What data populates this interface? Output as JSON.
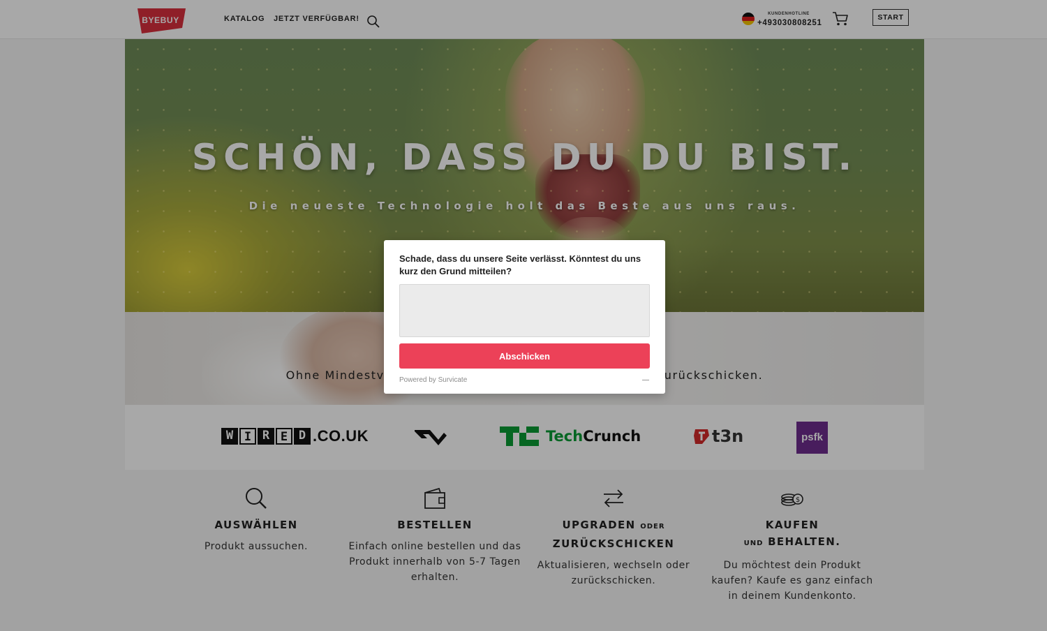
{
  "header": {
    "logo_text": "BYEBUY",
    "nav": [
      {
        "label": "KATALOG"
      },
      {
        "label": "JETZT VERFÜGBAR!"
      }
    ],
    "search_icon": "search-icon",
    "hotline_label": "KUNDENHOTLINE",
    "hotline_number": "+493030808251",
    "flag_icon": "germany-flag-icon",
    "cart_icon": "cart-icon",
    "start_label": "START"
  },
  "hero": {
    "title": "SCHÖN, DASS DU DU BIST.",
    "subtitle": "Die neueste Technologie holt das Beste aus uns raus."
  },
  "banner2": {
    "text": "Ohne Mindestvertragslaufzeit. Jederzeit upgraden oder zurückschicken."
  },
  "press": {
    "wired": [
      "W",
      "I",
      "R",
      "E",
      "D"
    ],
    "wired_tail": ".CO.UK",
    "techcrunch_a": "Tech",
    "techcrunch_b": "Crunch",
    "t3n": "t3n",
    "psfk": "psfk"
  },
  "steps": [
    {
      "icon": "search-icon",
      "title": "AUSWÄHLEN",
      "text": "Produkt aussuchen."
    },
    {
      "icon": "wallet-icon",
      "title": "BESTELLEN",
      "text": "Einfach online bestellen und das Produkt innerhalb von 5-7 Tagen erhalten."
    },
    {
      "icon": "swap-arrows-icon",
      "title_main": "UPGRADEN",
      "title_small": "ODER",
      "title_line2": "ZURÜCKSCHICKEN",
      "text": "Aktualisieren, wechseln oder zurückschicken."
    },
    {
      "icon": "coins-icon",
      "title_main": "KAUFEN",
      "title_small": "UND",
      "title_line2": "BEHALTEN.",
      "text": "Du möchtest dein Produkt kaufen? Kaufe es ganz einfach in deinem Kundenkonto."
    }
  ],
  "modal": {
    "question": "Schade, dass du unsere Seite verlässt. Könntest du uns kurz den Grund mitteilen?",
    "input_value": "",
    "submit_label": "Abschicken",
    "powered_by": "Powered by Survicate"
  },
  "colors": {
    "brand_red": "#d9303e",
    "submit_red": "#ec4158",
    "techcrunch_green": "#0a9b35",
    "psfk_purple": "#6e2d8e"
  }
}
